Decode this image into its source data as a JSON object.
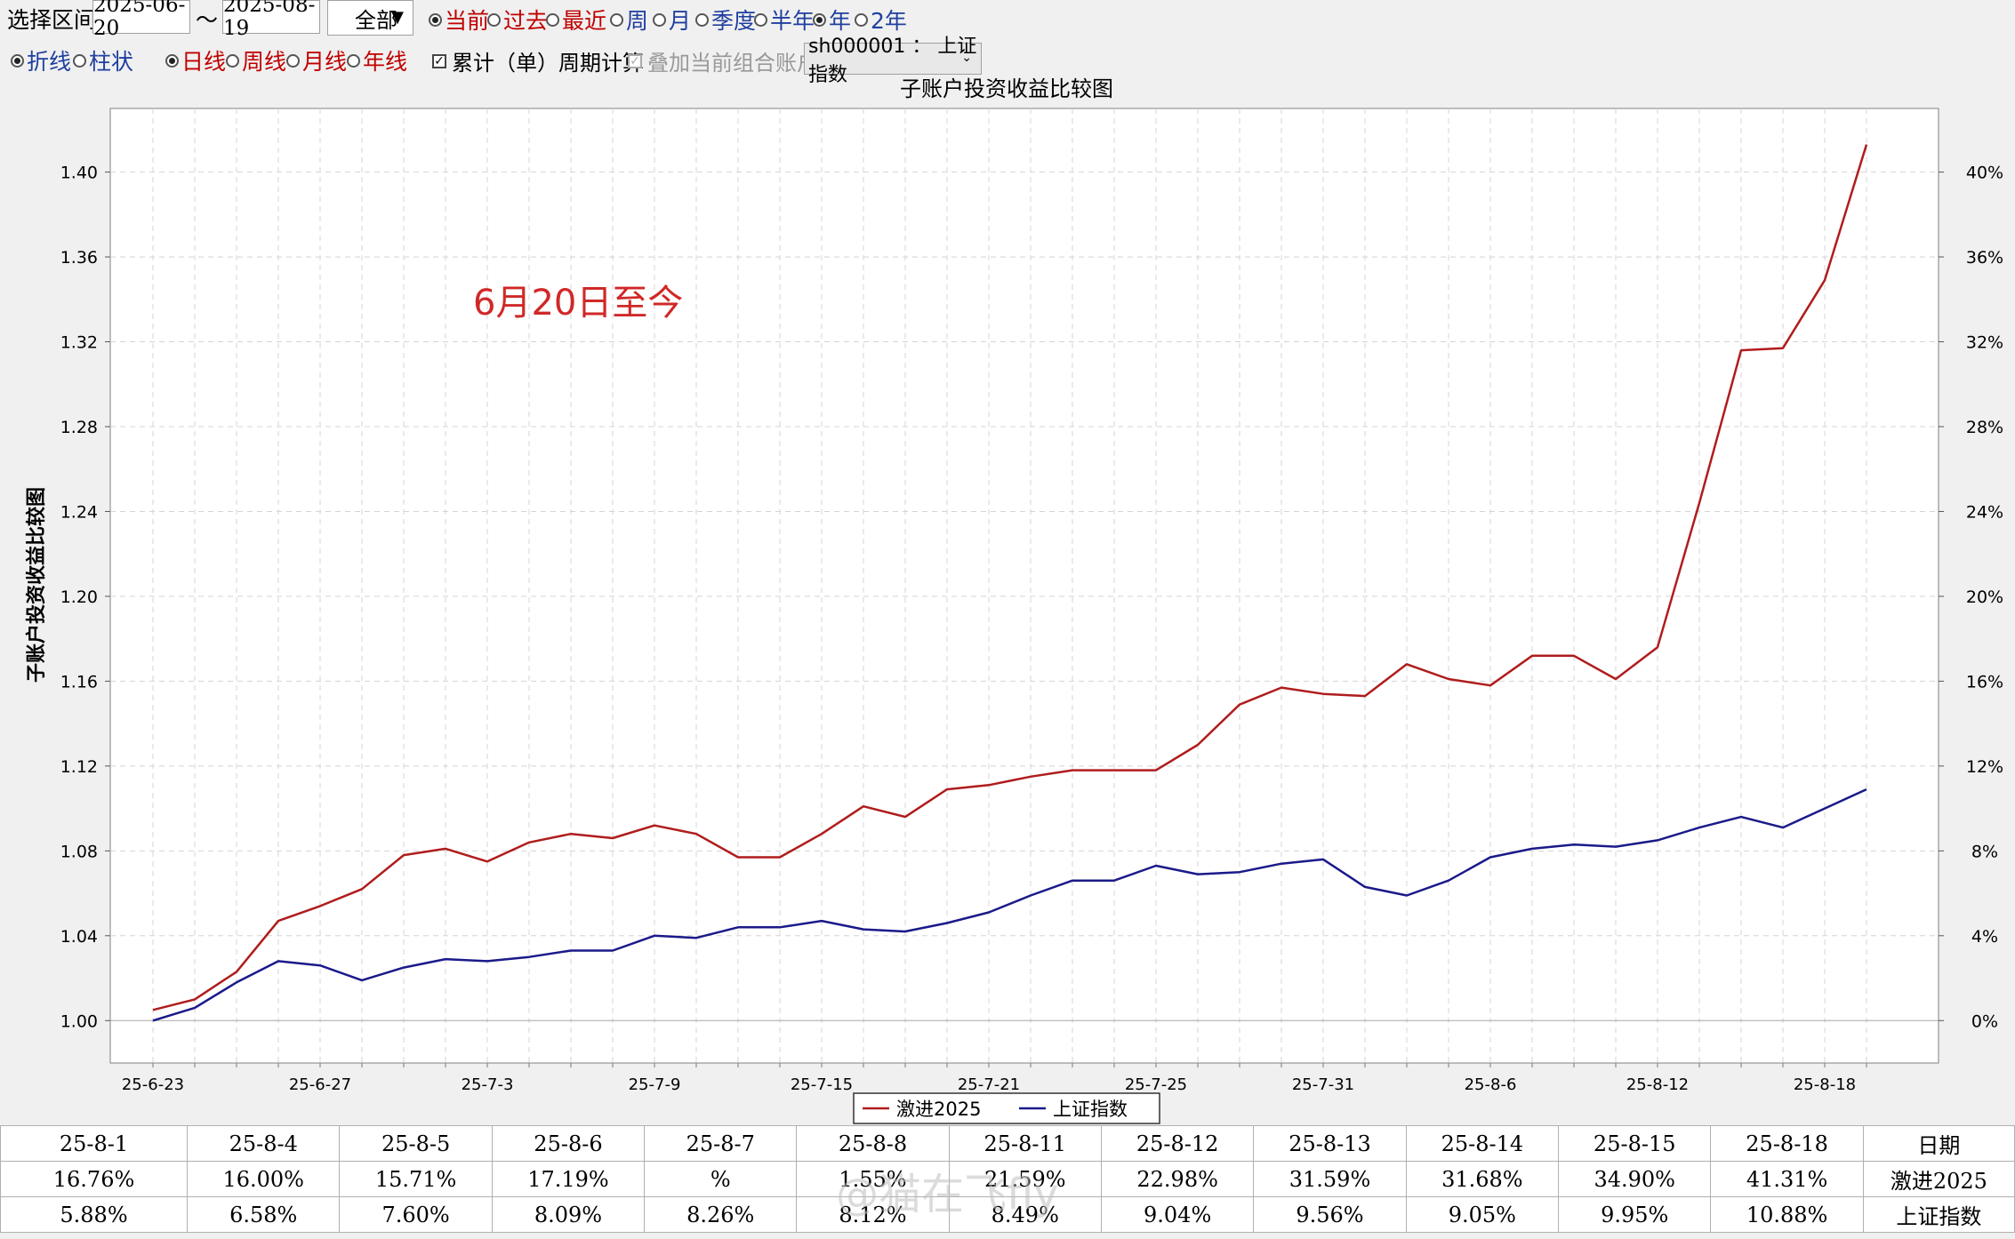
{
  "toolbar": {
    "range_label": "选择区间:",
    "date_from": "2025-06-20",
    "tilde": "〜",
    "date_to": "2025-08-19",
    "scope_select": "全部",
    "period_options": [
      {
        "label": "当前",
        "checked": true,
        "color": "#c00000"
      },
      {
        "label": "过去",
        "checked": false,
        "color": "#c00000"
      },
      {
        "label": "最近",
        "checked": false,
        "color": "#c00000"
      },
      {
        "label": "周",
        "checked": false,
        "color": "#1f3f9f"
      },
      {
        "label": "月",
        "checked": false,
        "color": "#1f3f9f"
      },
      {
        "label": "季度",
        "checked": false,
        "color": "#1f3f9f"
      },
      {
        "label": "半年",
        "checked": false,
        "color": "#1f3f9f"
      },
      {
        "label": "年",
        "checked": true,
        "color": "#1f3f9f"
      },
      {
        "label": "2年",
        "checked": false,
        "color": "#1f3f9f"
      }
    ],
    "chart_style_options": [
      {
        "label": "折线",
        "checked": true
      },
      {
        "label": "柱状",
        "checked": false
      }
    ],
    "interval_options": [
      {
        "label": "日线",
        "checked": true
      },
      {
        "label": "周线",
        "checked": false
      },
      {
        "label": "月线",
        "checked": false
      },
      {
        "label": "年线",
        "checked": false
      }
    ],
    "cumulative_check": {
      "label": "累计（单）周期计算",
      "checked": true
    },
    "overlay_check": {
      "label": "叠加当前组合账户",
      "checked": true,
      "disabled": true
    },
    "index_select": "sh000001 ： 上证指数"
  },
  "chart_data": {
    "type": "line",
    "title": "子账户投资收益比较图",
    "ylabel": "子账户投资收益比较图",
    "annotation": "6月20日至今",
    "ylim": [
      0.98,
      1.43
    ],
    "left_ticks": [
      "1.00",
      "1.04",
      "1.08",
      "1.12",
      "1.16",
      "1.20",
      "1.24",
      "1.28",
      "1.32",
      "1.36",
      "1.40"
    ],
    "right_ticks": [
      "0%",
      "4%",
      "8%",
      "12%",
      "16%",
      "20%",
      "24%",
      "28%",
      "32%",
      "36%",
      "40%"
    ],
    "x_labels": [
      "25-6-23",
      "25-6-27",
      "25-7-3",
      "25-7-9",
      "25-7-15",
      "25-7-21",
      "25-7-25",
      "25-7-31",
      "25-8-6",
      "25-8-12",
      "25-8-18"
    ],
    "series": [
      {
        "name": "激进2025",
        "color": "#b01c1c",
        "values": [
          1.005,
          1.01,
          1.023,
          1.047,
          1.054,
          1.062,
          1.078,
          1.081,
          1.075,
          1.084,
          1.088,
          1.086,
          1.092,
          1.088,
          1.077,
          1.077,
          1.088,
          1.101,
          1.096,
          1.109,
          1.111,
          1.115,
          1.118,
          1.118,
          1.118,
          1.13,
          1.149,
          1.157,
          1.154,
          1.153,
          1.168,
          1.161,
          1.158,
          1.172,
          1.172,
          1.161,
          1.176,
          1.244,
          1.316,
          1.317,
          1.349,
          1.413
        ]
      },
      {
        "name": "上证指数",
        "color": "#1a1a8a",
        "values": [
          1.0,
          1.006,
          1.018,
          1.028,
          1.026,
          1.019,
          1.025,
          1.029,
          1.028,
          1.03,
          1.033,
          1.033,
          1.04,
          1.039,
          1.044,
          1.044,
          1.047,
          1.043,
          1.042,
          1.046,
          1.051,
          1.059,
          1.066,
          1.066,
          1.073,
          1.069,
          1.07,
          1.074,
          1.076,
          1.063,
          1.059,
          1.066,
          1.077,
          1.081,
          1.083,
          1.082,
          1.085,
          1.091,
          1.096,
          1.091,
          1.1,
          1.109
        ]
      }
    ]
  },
  "table": {
    "rows": [
      [
        "25-8-1",
        "25-8-4",
        "25-8-5",
        "25-8-6",
        "25-8-7",
        "25-8-8",
        "25-8-11",
        "25-8-12",
        "25-8-13",
        "25-8-14",
        "25-8-15",
        "25-8-18",
        "日期"
      ],
      [
        "16.76%",
        "16.00%",
        "15.71%",
        "17.19%",
        "%",
        "1.55%",
        "21.59%",
        "22.98%",
        "31.59%",
        "31.68%",
        "34.90%",
        "41.31%",
        "激进2025"
      ],
      [
        "5.88%",
        "6.58%",
        "7.60%",
        "8.09%",
        "8.26%",
        "8.12%",
        "8.49%",
        "9.04%",
        "9.56%",
        "9.05%",
        "9.95%",
        "10.88%",
        "上证指数"
      ]
    ]
  },
  "watermark": "@猫在飞fly"
}
